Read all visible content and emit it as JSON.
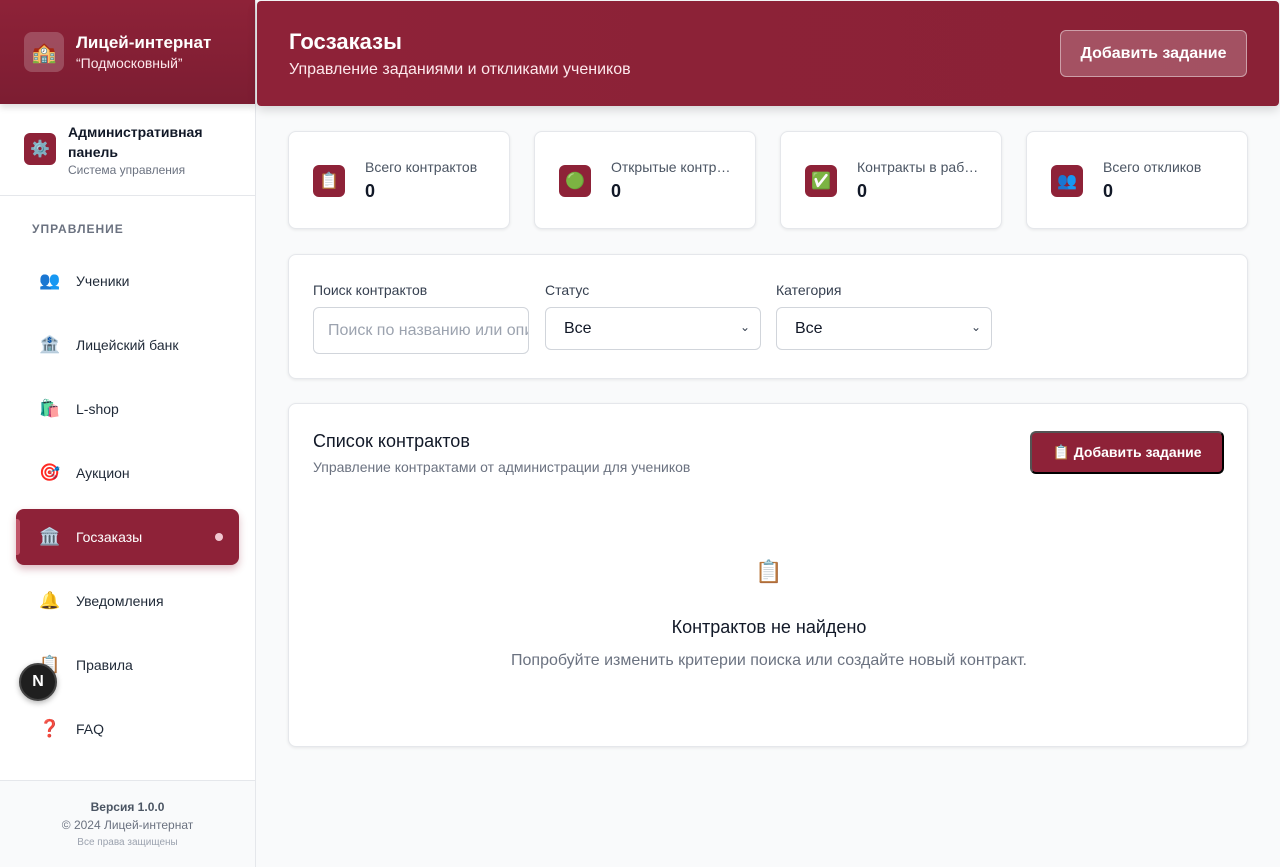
{
  "brand": {
    "logo_icon": "🏫",
    "title": "Лицей-интернат",
    "subtitle": "“Подмосковный”"
  },
  "admin": {
    "icon": "⚙️",
    "title": "Административная панель",
    "subtitle": "Система управления"
  },
  "sidebar": {
    "section_label": "УПРАВЛЕНИЕ",
    "items": [
      {
        "icon": "👥",
        "label": "Ученики"
      },
      {
        "icon": "🏦",
        "label": "Лицейский банк"
      },
      {
        "icon": "🛍️",
        "label": "L-shop"
      },
      {
        "icon": "🎯",
        "label": "Аукцион"
      },
      {
        "icon": "🏛️",
        "label": "Госзаказы"
      },
      {
        "icon": "🔔",
        "label": "Уведомления"
      },
      {
        "icon": "📋",
        "label": "Правила"
      },
      {
        "icon": "❓",
        "label": "FAQ"
      }
    ],
    "active_index": 4
  },
  "footer": {
    "version": "Версия 1.0.0",
    "copyright": "© 2024 Лицей-интернат",
    "rights": "Все права защищены"
  },
  "badge": {
    "letter": "N"
  },
  "header": {
    "title": "Госзаказы",
    "subtitle": "Управление заданиями и откликами учеников",
    "button": "Добавить задание"
  },
  "stats": [
    {
      "icon": "📋",
      "label": "Всего контрактов",
      "value": "0"
    },
    {
      "icon": "🟢",
      "label": "Открытые контракты",
      "value": "0"
    },
    {
      "icon": "✅",
      "label": "Контракты в работе",
      "value": "0"
    },
    {
      "icon": "👥",
      "label": "Всего откликов",
      "value": "0"
    }
  ],
  "filters": {
    "search_label": "Поиск контрактов",
    "search_placeholder": "Поиск по названию или описанию",
    "status_label": "Статус",
    "status_value": "Все",
    "category_label": "Категория",
    "category_value": "Все"
  },
  "list": {
    "title": "Список контрактов",
    "subtitle": "Управление контрактами от администрации для учеников",
    "button": "📋 Добавить задание",
    "empty_icon": "📋",
    "empty_title": "Контрактов не найдено",
    "empty_subtitle": "Попробуйте изменить критерии поиска или создайте новый контракт."
  },
  "colors": {
    "accent": "#8e2238",
    "background": "#f9fafb"
  }
}
